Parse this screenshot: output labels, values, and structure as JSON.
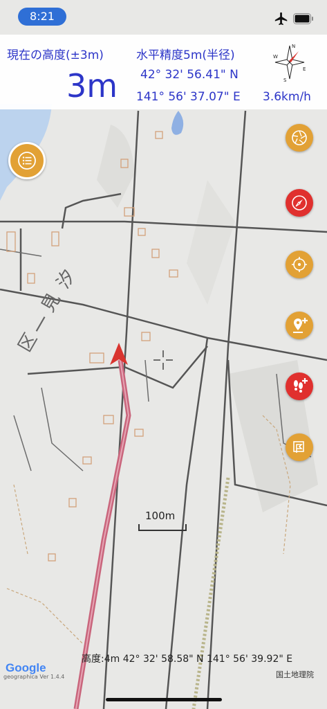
{
  "status_bar": {
    "time": "8:21"
  },
  "info_panel": {
    "altitude_label": "現在の高度(±3m)",
    "altitude_value": "3m",
    "accuracy_label": "水平精度5m(半径)",
    "latitude": "42° 32' 56.41\" N",
    "longitude": "141° 56' 37.07\" E",
    "speed": "3.6km/h",
    "compass_letters": {
      "n": "N",
      "s": "S",
      "e": "E",
      "w": "W"
    }
  },
  "map": {
    "scale_label": "100m",
    "map_labels": [
      "汐見一区"
    ],
    "bottom_position": "高度:4m  42° 32' 58.58\" N 141° 56' 39.92\" E",
    "attribution": "国土地理院",
    "google_logo": "Google",
    "google_sub": "geographica Ver 1.4.4"
  },
  "buttons": [
    {
      "name": "menu-button",
      "icon": "list-icon"
    },
    {
      "name": "map-type-button",
      "icon": "aperture-icon"
    },
    {
      "name": "compass-mode-button",
      "icon": "compass-needle-icon"
    },
    {
      "name": "current-location-button",
      "icon": "target-icon"
    },
    {
      "name": "add-waypoint-button",
      "icon": "pin-plus-icon"
    },
    {
      "name": "record-track-button",
      "icon": "footprints-icon"
    },
    {
      "name": "flag-button",
      "icon": "flag-icon"
    }
  ],
  "colors": {
    "accent_blue": "#2c35c8",
    "button_gold": "#e2a135",
    "button_red": "#e0302e",
    "track": "#c9657c",
    "time_pill": "#2f6fd6"
  }
}
